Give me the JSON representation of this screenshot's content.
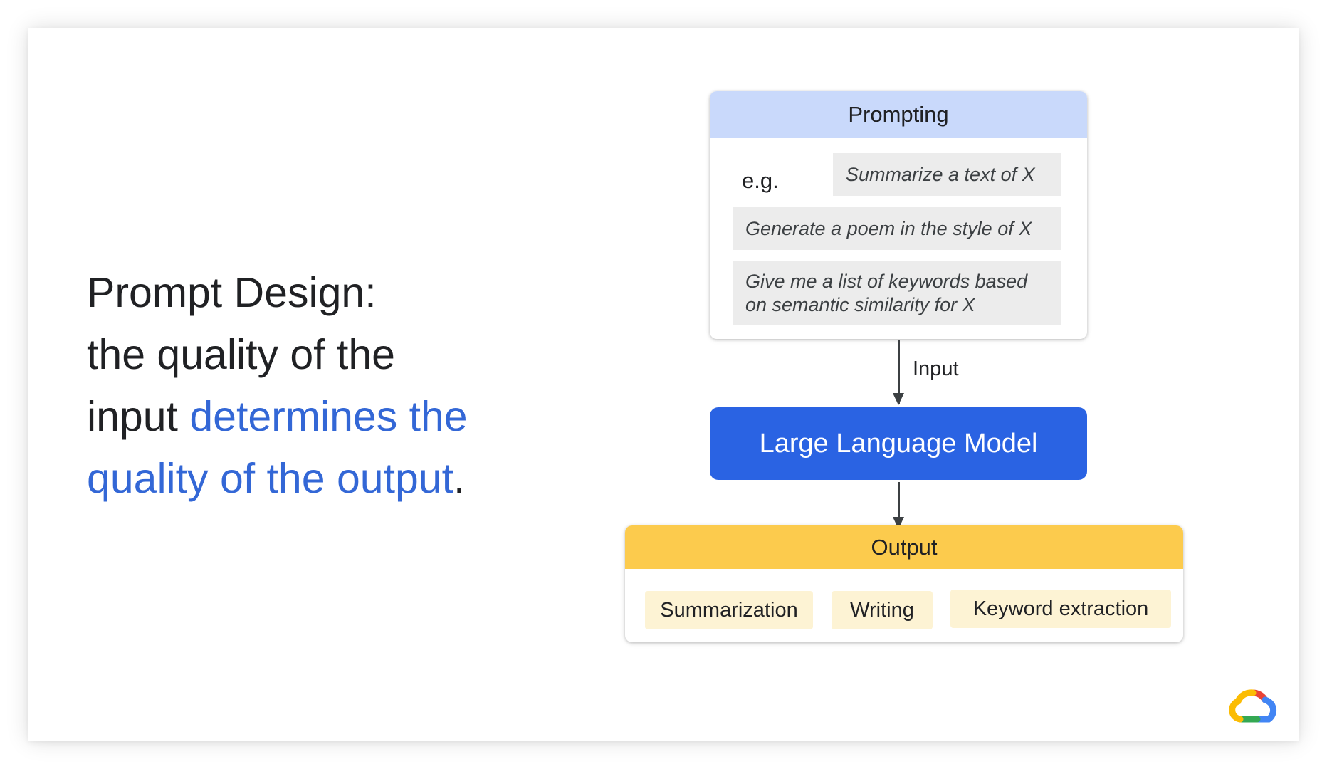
{
  "headline": {
    "line1": "Prompt Design:",
    "line2": "the quality of the",
    "line3_prefix": "input ",
    "line3_accent": "determines the",
    "line4_accent": "quality of the output",
    "line4_suffix": "."
  },
  "prompting": {
    "title": "Prompting",
    "eg_label": "e.g.",
    "examples": [
      "Summarize a text of X",
      "Generate a poem in the style of X",
      "Give me a list of keywords based on semantic similarity for X"
    ]
  },
  "input_label": "Input",
  "model": {
    "label": "Large Language Model"
  },
  "output": {
    "title": "Output",
    "items": [
      "Summarization",
      "Writing",
      "Keyword extraction"
    ]
  },
  "colors": {
    "accent_text": "#3367d6",
    "prompting_header": "#c9d9fb",
    "example_bg": "#ececec",
    "model_box": "#2a63e3",
    "output_header": "#fccb4d",
    "output_chip": "#fdf3d4"
  },
  "icons": {
    "logo": "google-cloud-logo-icon"
  }
}
